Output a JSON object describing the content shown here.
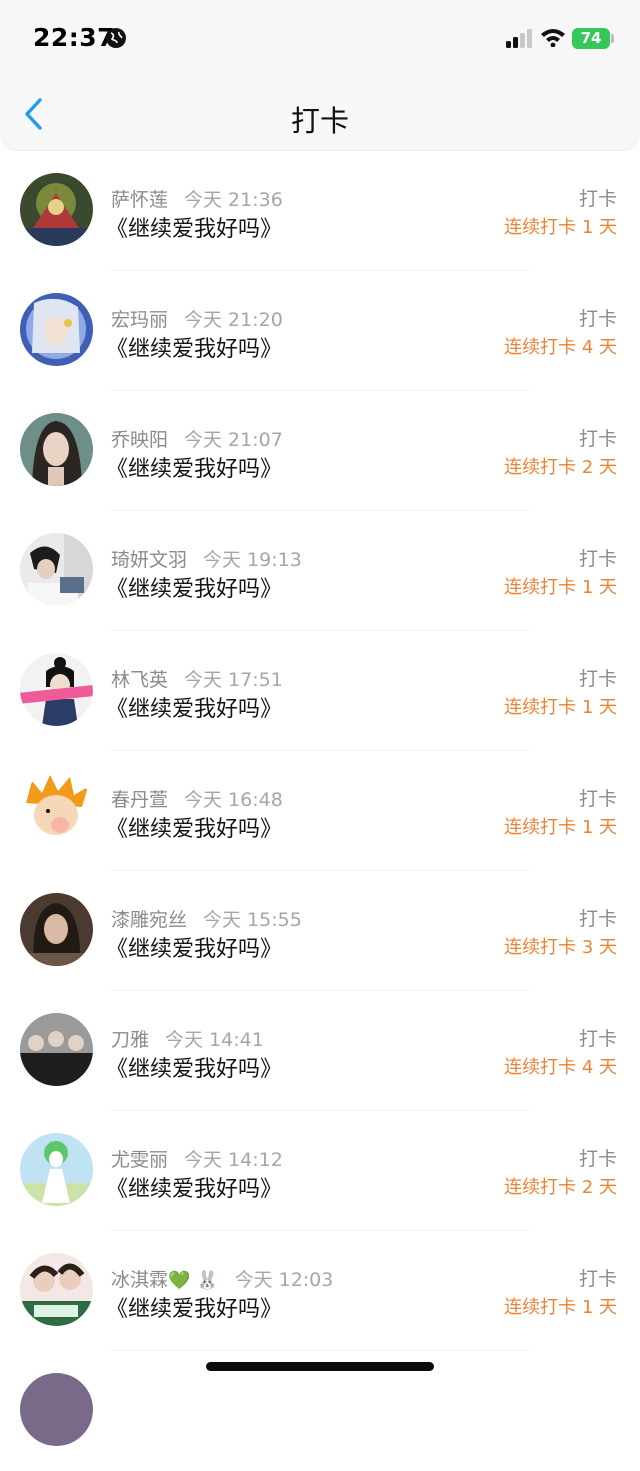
{
  "status_bar": {
    "time": "22:37",
    "battery": "74"
  },
  "nav": {
    "title": "打卡",
    "back_icon": "chevron-left-icon"
  },
  "colors": {
    "accent": "#e98336",
    "back": "#1d9bf0",
    "battery": "#34c759"
  },
  "entries": [
    {
      "name": "萨怀莲",
      "emoji": "",
      "time": "今天 21:36",
      "book": "《继续爱我好吗》",
      "kind": "打卡",
      "streak": "连续打卡 1 天"
    },
    {
      "name": "宏玛丽",
      "emoji": "",
      "time": "今天 21:20",
      "book": "《继续爱我好吗》",
      "kind": "打卡",
      "streak": "连续打卡 4 天"
    },
    {
      "name": "乔映阳",
      "emoji": "",
      "time": "今天 21:07",
      "book": "《继续爱我好吗》",
      "kind": "打卡",
      "streak": "连续打卡 2 天"
    },
    {
      "name": "琦妍文羽",
      "emoji": "",
      "time": "今天 19:13",
      "book": "《继续爱我好吗》",
      "kind": "打卡",
      "streak": "连续打卡 1 天"
    },
    {
      "name": "林飞英",
      "emoji": "",
      "time": "今天 17:51",
      "book": "《继续爱我好吗》",
      "kind": "打卡",
      "streak": "连续打卡 1 天"
    },
    {
      "name": "春丹萱",
      "emoji": "",
      "time": "今天 16:48",
      "book": "《继续爱我好吗》",
      "kind": "打卡",
      "streak": "连续打卡 1 天"
    },
    {
      "name": "漆雕宛丝",
      "emoji": "",
      "time": "今天 15:55",
      "book": "《继续爱我好吗》",
      "kind": "打卡",
      "streak": "连续打卡 3 天"
    },
    {
      "name": "刀雅",
      "emoji": "",
      "time": "今天 14:41",
      "book": "《继续爱我好吗》",
      "kind": "打卡",
      "streak": "连续打卡 4 天"
    },
    {
      "name": "尤雯丽",
      "emoji": "",
      "time": "今天 14:12",
      "book": "《继续爱我好吗》",
      "kind": "打卡",
      "streak": "连续打卡 2 天"
    },
    {
      "name": "冰淇霖",
      "emoji": "💚 🐰",
      "time": "今天 12:03",
      "book": "《继续爱我好吗》",
      "kind": "打卡",
      "streak": "连续打卡 1 天"
    }
  ]
}
